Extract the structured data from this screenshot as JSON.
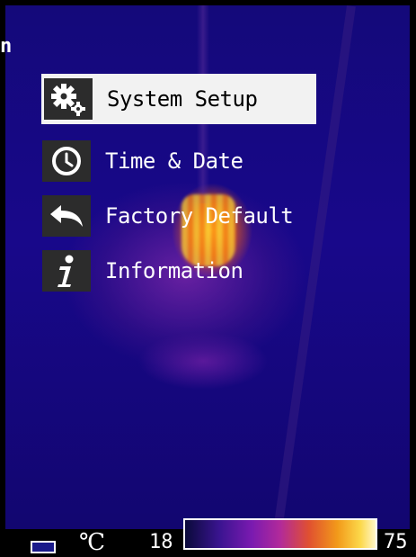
{
  "overlay": {
    "corner_glyph": "n"
  },
  "menu": {
    "items": [
      {
        "label": "System Setup",
        "icon": "gears-icon",
        "selected": true
      },
      {
        "label": "Time & Date",
        "icon": "clock-icon",
        "selected": false
      },
      {
        "label": "Factory Default",
        "icon": "undo-arrow-icon",
        "selected": false
      },
      {
        "label": "Information",
        "icon": "info-icon",
        "selected": false
      }
    ]
  },
  "status": {
    "battery_icon": "battery-icon",
    "unit": "℃",
    "range_min": "18",
    "range_max": "75"
  },
  "colors": {
    "selected_bg": "#f2f2f2",
    "icon_bg": "#2c2c2c",
    "thermal_bg": "#14097a"
  }
}
